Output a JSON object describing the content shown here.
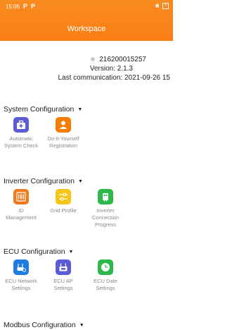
{
  "status": {
    "time": "15:06",
    "indicators": [
      "P",
      "P"
    ],
    "bluetooth_icon": "bluetooth-icon",
    "close_icon": "close-box-icon"
  },
  "header": {
    "title": "Workspace",
    "color": "#fa8219"
  },
  "device": {
    "serial": "216200015257",
    "version": "Version: 2.1.3",
    "last_comm": "Last communication: 2021-09-26 15"
  },
  "sections": [
    {
      "title": "System Configuration",
      "items": [
        {
          "label": "Automatic System Check",
          "icon": "medkit-icon",
          "color": "#5b5bd6"
        },
        {
          "label": "Do-It-Yourself Registration",
          "icon": "person-icon",
          "color": "#f57c00"
        }
      ]
    },
    {
      "title": "Inverter Configuration",
      "items": [
        {
          "label": "ID Management",
          "icon": "barcode-icon",
          "color": "#ef7a1e"
        },
        {
          "label": "Grid Profile",
          "icon": "sliders-icon",
          "color": "#f5c518"
        },
        {
          "label": "Inverter Connection Progress",
          "icon": "inverter-icon",
          "color": "#2fb84a"
        }
      ]
    },
    {
      "title": "ECU Configuration",
      "items": [
        {
          "label": "ECU Network Settings",
          "icon": "ecu-network-icon",
          "color": "#1e7be0"
        },
        {
          "label": "ECU AP Settings",
          "icon": "ecu-ap-icon",
          "color": "#5b5bd6"
        },
        {
          "label": "ECU Date Settings",
          "icon": "clock-icon",
          "color": "#2fb84a"
        }
      ]
    },
    {
      "title": "Modbus Configuration",
      "items": []
    }
  ]
}
